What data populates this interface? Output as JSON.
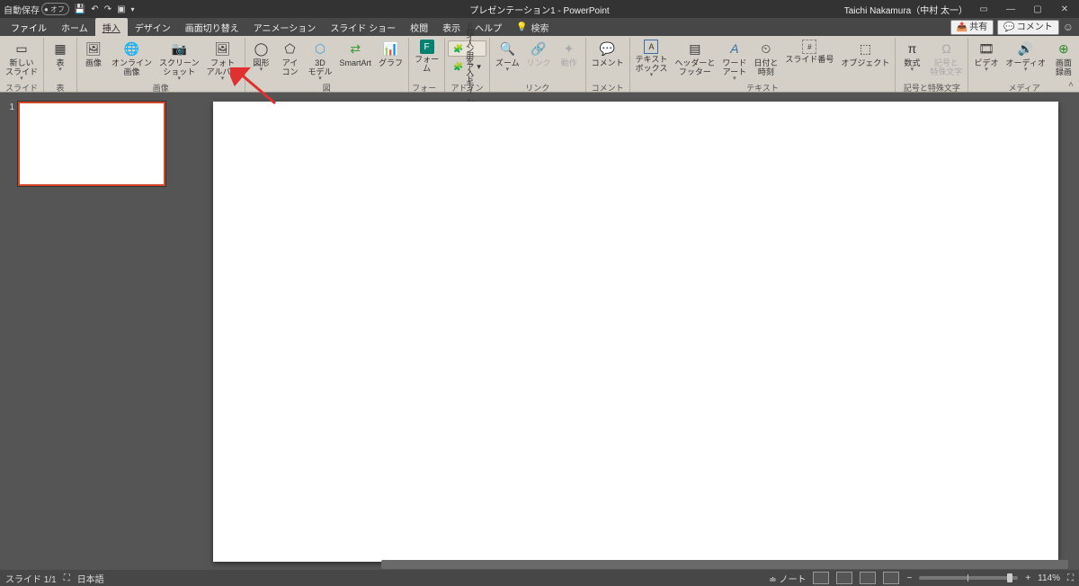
{
  "titlebar": {
    "autosave_label": "自動保存",
    "autosave_state": "オフ",
    "title_text": "プレゼンテーション1 - PowerPoint",
    "user_name": "Taichi Nakamura（中村 太一）"
  },
  "tabs": {
    "file": "ファイル",
    "home": "ホーム",
    "insert": "挿入",
    "design": "デザイン",
    "transitions": "画面切り替え",
    "animations": "アニメーション",
    "slideshow": "スライド ショー",
    "review": "校閲",
    "view": "表示",
    "help": "ヘルプ",
    "tell_me_icon": "💡",
    "tell_me": "検索",
    "share_label": "共有",
    "comment_label": "コメント"
  },
  "ribbon": {
    "groups": {
      "slides": {
        "label": "スライド",
        "new_slide": "新しい\nスライド"
      },
      "tables": {
        "label": "表",
        "table": "表"
      },
      "images": {
        "label": "画像",
        "picture": "画像",
        "online_picture": "オンライン\n画像",
        "screenshot": "スクリーン\nショット",
        "photo_album": "フォト\nアルバム"
      },
      "illustrations": {
        "label": "図",
        "shapes": "図形",
        "icons": "アイ\nコン",
        "models3d": "3D\nモデル",
        "smartart": "SmartArt",
        "chart": "グラフ"
      },
      "forms": {
        "label": "フォーム",
        "form": "フォー\nム"
      },
      "addins": {
        "label": "アドイン",
        "get_addins": "アドインを入手",
        "my_addins": "個人用アドイン"
      },
      "links": {
        "label": "リンク",
        "zoom": "ズーム",
        "link": "リンク",
        "action": "動作"
      },
      "comments": {
        "label": "コメント",
        "comment": "コメント"
      },
      "text": {
        "label": "テキスト",
        "textbox": "テキスト\nボックス",
        "headerfooter": "ヘッダーと\nフッター",
        "wordart": "ワード\nアート",
        "datetime": "日付と\n時刻",
        "slidenum": "スライド番号",
        "object": "オブジェクト"
      },
      "symbols": {
        "label": "記号と特殊文字",
        "equation": "数式",
        "symbol": "記号と\n特殊文字"
      },
      "media": {
        "label": "メディア",
        "video": "ビデオ",
        "audio": "オーディオ",
        "screenrec": "画面\n録画"
      }
    }
  },
  "thumbnails": {
    "items": [
      {
        "num": "1"
      }
    ]
  },
  "statusbar": {
    "slide_indicator": "スライド 1/1",
    "language": "日本語",
    "notes_label": "ノート",
    "zoom_pct": "114%"
  }
}
